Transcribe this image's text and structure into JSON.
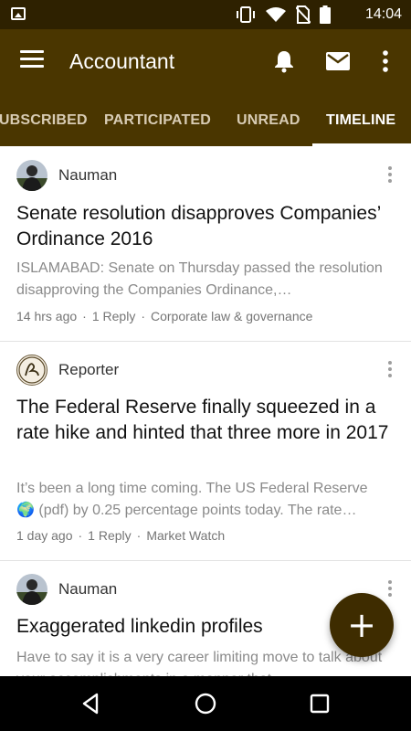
{
  "status_bar": {
    "time": "14:04",
    "icons": [
      "image-icon",
      "vibrate-icon",
      "wifi-icon",
      "no-sim-icon",
      "battery-icon"
    ]
  },
  "app_bar": {
    "title": "Accountant",
    "icons": [
      "menu-icon",
      "bell-icon",
      "mail-icon",
      "more-vert-icon"
    ],
    "color": "#4a3600"
  },
  "tabs": [
    {
      "label": "SUBSCRIBED",
      "active": false
    },
    {
      "label": "PARTICIPATED",
      "active": false
    },
    {
      "label": "UNREAD",
      "active": false
    },
    {
      "label": "TIMELINE",
      "active": true
    }
  ],
  "posts": [
    {
      "author": "Nauman",
      "title": "Senate resolution disapproves Companies’ Ordinance 2016",
      "excerpt": "ISLAMABAD: Senate on Thursday passed the resolution disapproving the Companies Ordinance,…",
      "time": "14 hrs ago",
      "replies": "1 Reply",
      "category": "Corporate law & governance"
    },
    {
      "author": "Reporter",
      "title": "The Federal Reserve finally squeezed in a rate hike and hinted that three more in 2017",
      "excerpt_line1": "It’s been a long time coming. The US Federal Reserve",
      "excerpt_line2": "(pdf) by 0.25 percentage points today. The rate…",
      "excerpt_icon": "🌍",
      "time": "1 day ago",
      "replies": "1 Reply",
      "category": "Market Watch"
    },
    {
      "author": "Nauman",
      "title": "Exaggerated linkedin profiles",
      "excerpt": "Have to say it is a very career limiting move to talk about your accomplishments in a manner that"
    }
  ],
  "fab": {
    "label": "+",
    "color": "#3e2c00"
  },
  "nav_bar": {
    "icons": [
      "back-icon",
      "home-icon",
      "recents-icon"
    ]
  }
}
